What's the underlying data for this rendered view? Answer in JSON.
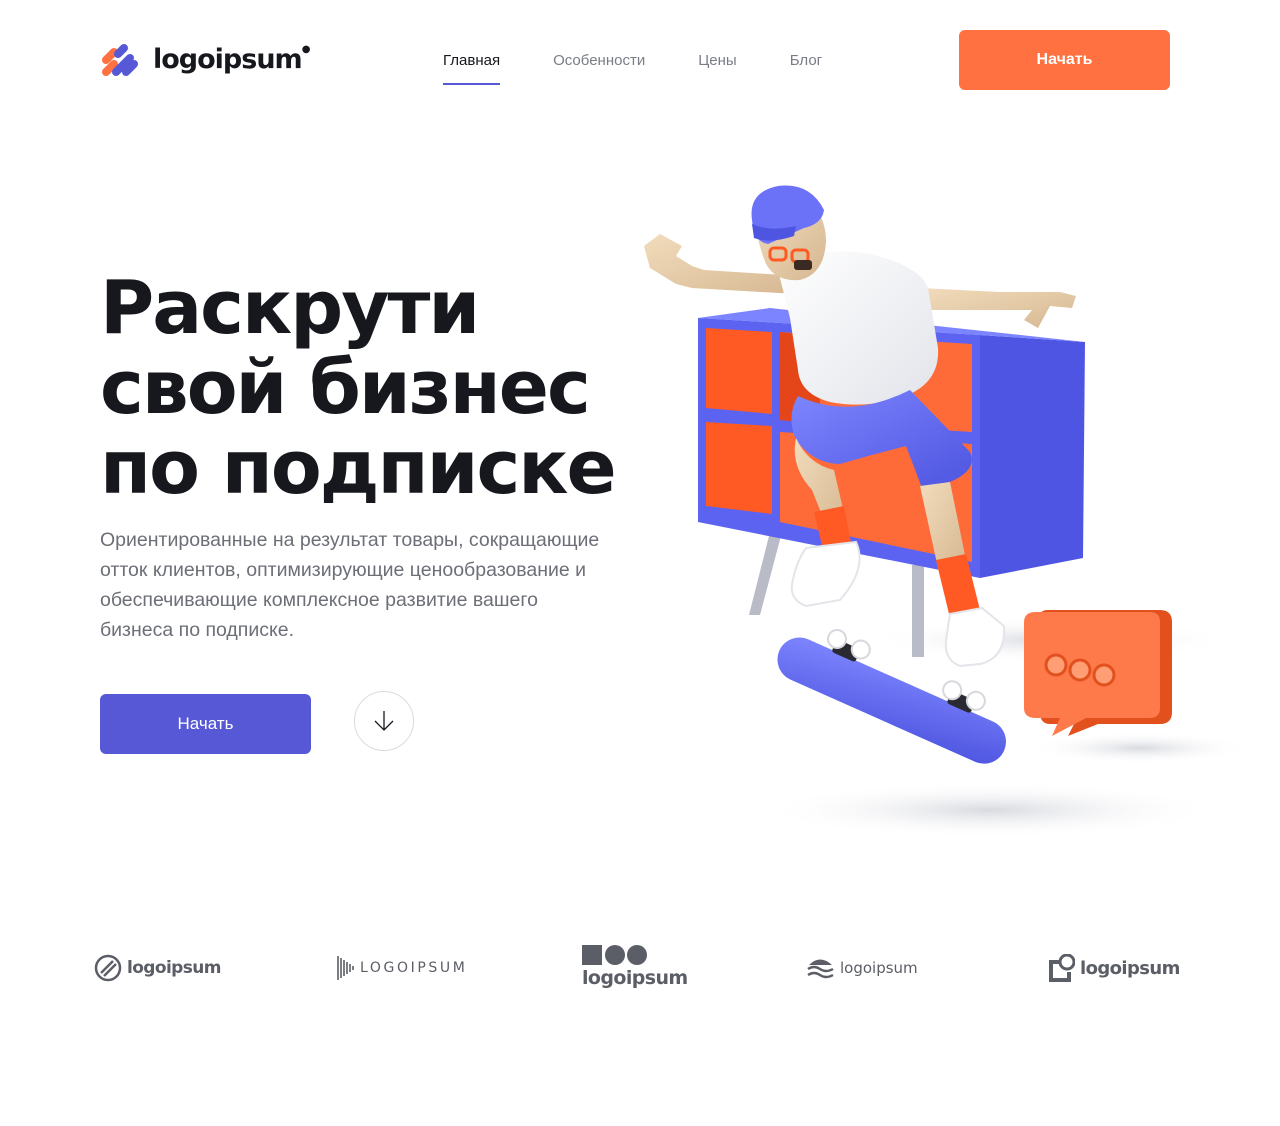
{
  "header": {
    "logo_text": "logoipsum",
    "nav": [
      {
        "label": "Главная",
        "active": true
      },
      {
        "label": "Особенности",
        "active": false
      },
      {
        "label": "Цены",
        "active": false
      },
      {
        "label": "Блог",
        "active": false
      }
    ],
    "cta_label": "Начать"
  },
  "hero": {
    "title_lines": [
      "Раскрути",
      "свой бизнес",
      "по подписке"
    ],
    "description": "Ориентированные на результат товары, сокращающие отток клиентов, оптимизирующие ценообразование и обеспечивающие комплексное развитие вашего бизнеса по подписке.",
    "cta_label": "Начать",
    "scroll_icon": "arrow-down-icon"
  },
  "partners": [
    {
      "text": "logoipsum",
      "icon": "circle-stripes-icon"
    },
    {
      "text": "LOGOIPSUM",
      "icon": "barcode-lines-icon"
    },
    {
      "text": "logoipsum",
      "icon": "square-circles-icon"
    },
    {
      "text": "logoipsum",
      "icon": "waves-icon"
    },
    {
      "text": "logoipsum",
      "icon": "square-pin-icon"
    }
  ],
  "colors": {
    "accent_orange": "#ff7141",
    "accent_blue": "#5758d6",
    "text_dark": "#16181d",
    "text_muted": "#6c6f77",
    "partner_gray": "#5b5e66"
  }
}
